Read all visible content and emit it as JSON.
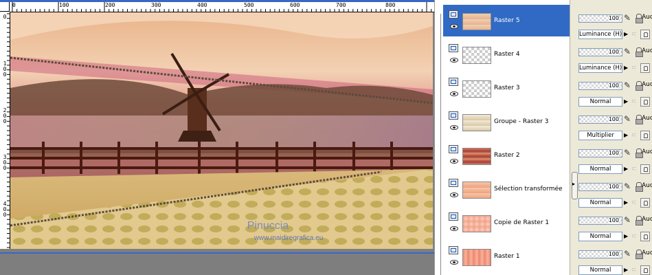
{
  "ruler": {
    "h_labels": [
      "0",
      "100",
      "200",
      "300",
      "400",
      "500",
      "600",
      "700",
      "800"
    ],
    "v_labels": [
      "0",
      "100",
      "200",
      "300",
      "400"
    ]
  },
  "canvas": {
    "watermark_name": "Pinuccia",
    "watermark_url": "www.maidiregrafica.eu"
  },
  "layers": [
    {
      "name": "Raster 5",
      "opacity": "100",
      "blend": "Luminance (H)",
      "selected": true
    },
    {
      "name": "Raster 4",
      "opacity": "100",
      "blend": "Luminance (H)",
      "selected": false
    },
    {
      "name": "Raster 3",
      "opacity": "100",
      "blend": "Normal",
      "selected": false
    },
    {
      "name": "Groupe - Raster 3",
      "opacity": "100",
      "blend": "Multiplier",
      "selected": false
    },
    {
      "name": "Raster 2",
      "opacity": "100",
      "blend": "Normal",
      "selected": false
    },
    {
      "name": "Sélection transformée",
      "opacity": "100",
      "blend": "Normal",
      "selected": false
    },
    {
      "name": "Copie de Raster 1",
      "opacity": "100",
      "blend": "Normal",
      "selected": false
    },
    {
      "name": "Raster 1",
      "opacity": "100",
      "blend": "Normal",
      "selected": false
    }
  ],
  "mask_label": "Aucu",
  "colors": {
    "selection": "#316ac5",
    "panel": "#ece9d8"
  }
}
